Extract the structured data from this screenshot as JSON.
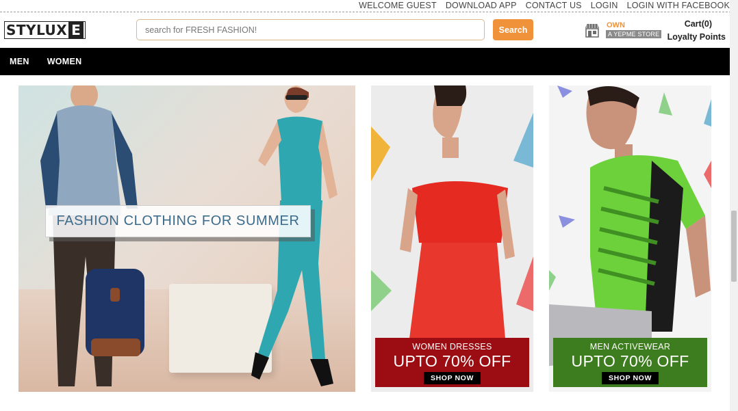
{
  "topbar": {
    "links": [
      "WELCOME GUEST",
      "DOWNLOAD APP",
      "CONTACT US",
      "LOGIN",
      "LOGIN WITH FACEBOOK"
    ]
  },
  "header": {
    "logo_text": "STYLUX",
    "logo_letter": "E",
    "search": {
      "placeholder": "search for FRESH FASHION!",
      "value": ""
    },
    "search_button": "Search",
    "own_label": "OWN",
    "store_label": "A YEPME STORE",
    "cart": "Cart(0)",
    "loyalty": "Loyalty Points"
  },
  "nav": {
    "items": [
      "MEN",
      "WOMEN"
    ]
  },
  "hero": {
    "caption": "FASHION CLOTHING FOR SUMMER"
  },
  "promos": [
    {
      "title": "WOMEN DRESSES",
      "offer": "UPTO 70% OFF",
      "cta": "SHOP NOW",
      "color": "#9b0d12"
    },
    {
      "title": "MEN ACTIVEWEAR",
      "offer": "UPTO 70% OFF",
      "cta": "SHOP NOW",
      "color": "#3e7d1f"
    }
  ],
  "colors": {
    "accent": "#f0923a",
    "nav_bg": "#000000",
    "caption_text": "#3b6b8c"
  }
}
